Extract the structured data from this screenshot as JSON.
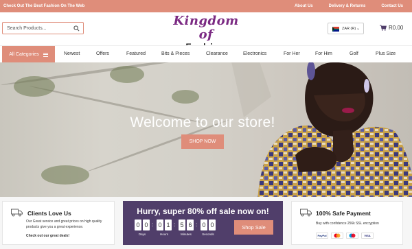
{
  "topbar": {
    "tagline": "Check Out The Best Fashion On The Web",
    "links": [
      "About Us",
      "Delivery & Returns",
      "Contact Us"
    ]
  },
  "header": {
    "search_placeholder": "Search Products...",
    "logo_line1": "Kingdom of",
    "logo_line2": "Fashion",
    "currency": "ZAR (R)",
    "cart_total": "R0.00"
  },
  "nav": {
    "all_categories": "All Categories",
    "items": [
      "Newest",
      "Offers",
      "Featured",
      "Bits & Pieces",
      "Clearance",
      "Electronics",
      "For Her",
      "For Him",
      "Golf",
      "Plus Size"
    ]
  },
  "hero": {
    "title": "Welcome to our store!",
    "button": "SHOP NOW"
  },
  "features": {
    "clients": {
      "title": "Clients Love Us",
      "text": "Our Great service and great prices on high quality products give you a great experience.",
      "link": "Check out our great deals!"
    },
    "promo": {
      "title": "Hurry, super 80% off sale now on!",
      "countdown": {
        "days": [
          "0",
          "0"
        ],
        "hours": [
          "0",
          "1"
        ],
        "minutes": [
          "5",
          "6"
        ],
        "seconds": [
          "0",
          "0"
        ]
      },
      "labels": [
        "Days",
        "Hours",
        "Minutes",
        "Seconds"
      ],
      "button": "Shop Sale"
    },
    "payment": {
      "title": "100% Safe Payment",
      "text": "Buy with confidence 256k SSL encryption",
      "methods": [
        "PayPal",
        "Mastercard",
        "Maestro",
        "VISA"
      ]
    }
  },
  "colors": {
    "accent": "#df8d7a",
    "promo_bg": "#503e6a",
    "logo_purple": "#7b2a83"
  }
}
